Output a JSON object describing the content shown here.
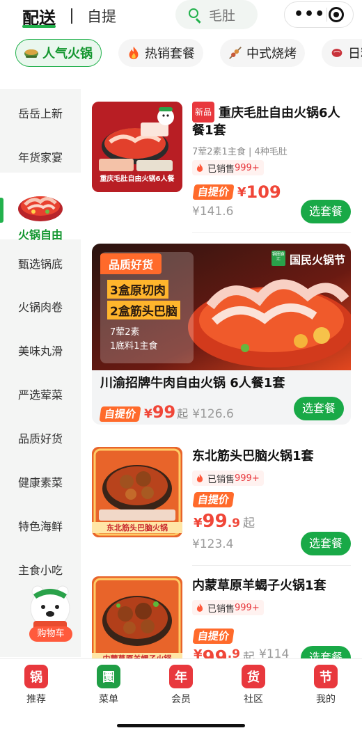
{
  "header": {
    "tab_delivery": "配送",
    "tab_pickup": "自提",
    "search_placeholder": "毛肚"
  },
  "categories": [
    {
      "label": "人气火锅",
      "icon": "hotpot-bowl-icon",
      "active": true
    },
    {
      "label": "热销套餐",
      "icon": "fire-icon",
      "active": false
    },
    {
      "label": "中式烧烤",
      "icon": "skewer-icon",
      "active": false
    },
    {
      "label": "日料",
      "icon": "meat-icon",
      "active": false
    }
  ],
  "sidebar": {
    "items": [
      "岳岳上新",
      "年货家宴",
      "火锅自由",
      "甄选锅底",
      "火锅肉卷",
      "美味丸滑",
      "严选荤菜",
      "品质好货",
      "健康素菜",
      "特色海鲜",
      "主食小吃"
    ],
    "active": "火锅自由",
    "cart_label": "购物车"
  },
  "products": [
    {
      "tag": "新品",
      "title_line1": "重庆毛肚自由火锅6人",
      "title_line2": "餐1套",
      "subtitle": "7荤2素1主食 | 4种毛肚",
      "sold_prefix": "已销售",
      "sold_count": "999+",
      "price_tag": "自提价",
      "currency": "¥",
      "price": "109",
      "orig_price": "¥141.6",
      "button": "选套餐",
      "thumb_caption": "重庆毛肚自由火锅6人餐"
    },
    {
      "banner_badge": "品质好货",
      "banner_line1": "3盒原切肉",
      "banner_line2": "2盒筋头巴脑",
      "banner_line3": "7荤2素",
      "banner_line4": "1底料1主食",
      "banner_logo_small": "锅圈食汇",
      "banner_logo": "国民火锅节",
      "title": "川渝招牌牛肉自由火锅 6人餐1套",
      "price_tag": "自提价",
      "currency": "¥",
      "price": "99",
      "price_suffix": "起",
      "orig_price": "¥126.6",
      "button": "选套餐"
    },
    {
      "title": "东北筋头巴脑火锅1套",
      "sold_prefix": "已销售",
      "sold_count": "999+",
      "price_tag": "自提价",
      "currency": "¥",
      "price": "99",
      "price_decimal": ".9",
      "price_suffix": "起",
      "orig_price": "¥123.4",
      "button": "选套餐",
      "thumb_caption": "东北筋头巴脑火锅"
    },
    {
      "title": "内蒙草原羊蝎子火锅1套",
      "sold_prefix": "已销售",
      "sold_count": "999+",
      "price_tag": "自提价",
      "currency": "¥",
      "price": "99",
      "price_decimal": ".9",
      "price_suffix": "起",
      "orig_price": "¥114",
      "button": "选套餐",
      "thumb_caption": "内蒙草原羊蝎子火锅"
    }
  ],
  "bottom_nav": [
    {
      "glyph": "锅",
      "label": "推荐",
      "color": "#e8383d"
    },
    {
      "glyph": "圜",
      "label": "菜单",
      "color": "#1f9e45"
    },
    {
      "glyph": "年",
      "label": "会员",
      "color": "#e8383d"
    },
    {
      "glyph": "货",
      "label": "社区",
      "color": "#e8383d"
    },
    {
      "glyph": "节",
      "label": "我的",
      "color": "#e8383d"
    }
  ],
  "colors": {
    "brand_green": "#22b14c",
    "price_red": "#f04638",
    "accent_orange": "#ff6a2b"
  }
}
